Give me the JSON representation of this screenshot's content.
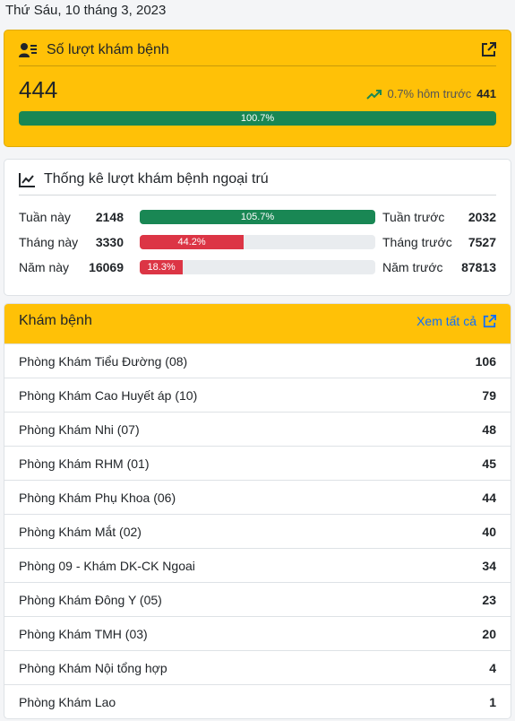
{
  "date": "Thứ Sáu, 10 tháng 3, 2023",
  "visits": {
    "title": "Số lượt khám bệnh",
    "icon": "user-card-icon",
    "external_icon": "external-link-icon",
    "count": "444",
    "trend_icon": "trending-up-icon",
    "trend_text": "0.7% hôm trước",
    "previous": "441",
    "progress_label": "100.7%",
    "progress_fraction": 1.0,
    "colors": {
      "card": "#ffc107",
      "bar": "#198754",
      "trend": "#198754"
    }
  },
  "stats": {
    "title": "Thống kê lượt khám bệnh ngoại trú",
    "icon": "line-chart-icon",
    "rows": [
      {
        "label": "Tuần này",
        "value": "2148",
        "bar_label": "105.7%",
        "fraction": 1.0,
        "color": "#198754",
        "prev_label": "Tuần trước",
        "prev_value": "2032"
      },
      {
        "label": "Tháng này",
        "value": "3330",
        "bar_label": "44.2%",
        "fraction": 0.442,
        "color": "#dc3545",
        "prev_label": "Tháng trước",
        "prev_value": "7527"
      },
      {
        "label": "Năm này",
        "value": "16069",
        "bar_label": "18.3%",
        "fraction": 0.183,
        "color": "#dc3545",
        "prev_label": "Năm trước",
        "prev_value": "87813"
      }
    ]
  },
  "clinics": {
    "title": "Khám bệnh",
    "see_all": "Xem tất cả",
    "link_color": "#0d6efd",
    "items": [
      {
        "name": "Phòng Khám Tiểu Đường (08)",
        "count": "106"
      },
      {
        "name": "Phòng Khám Cao Huyết áp (10)",
        "count": "79"
      },
      {
        "name": "Phòng Khám Nhi (07)",
        "count": "48"
      },
      {
        "name": "Phòng Khám RHM (01)",
        "count": "45"
      },
      {
        "name": "Phòng Khám Phụ Khoa (06)",
        "count": "44"
      },
      {
        "name": "Phòng Khám Mắt (02)",
        "count": "40"
      },
      {
        "name": "Phòng 09 - Khám DK-CK Ngoai",
        "count": "34"
      },
      {
        "name": "Phòng Khám Đông Y (05)",
        "count": "23"
      },
      {
        "name": "Phòng Khám TMH (03)",
        "count": "20"
      },
      {
        "name": "Phòng Khám Nội tổng hợp",
        "count": "4"
      },
      {
        "name": "Phòng Khám Lao",
        "count": "1"
      }
    ]
  }
}
